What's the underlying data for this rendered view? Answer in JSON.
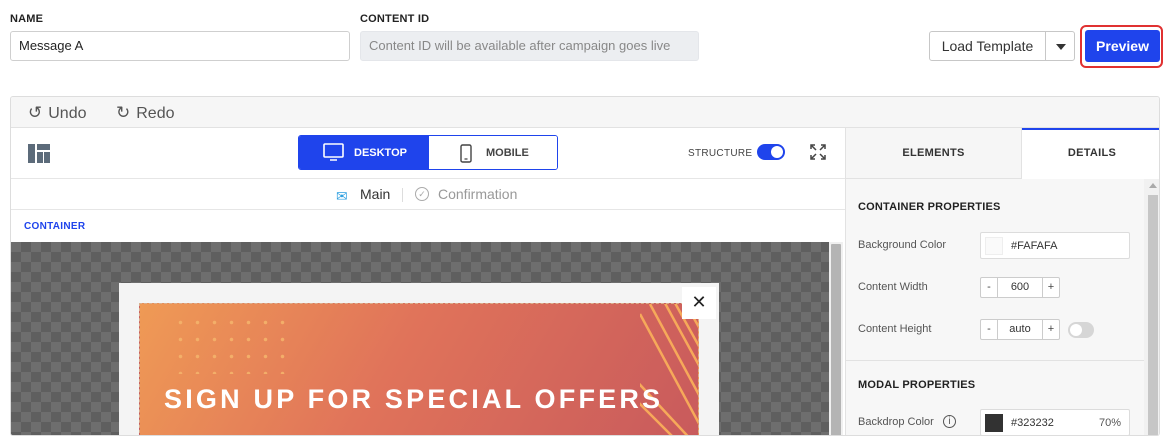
{
  "header": {
    "name_label": "NAME",
    "name_value": "Message A",
    "content_id_label": "CONTENT ID",
    "content_id_placeholder": "Content ID will be available after campaign goes live",
    "load_template_label": "Load Template",
    "preview_label": "Preview"
  },
  "history": {
    "undo_label": "Undo",
    "redo_label": "Redo"
  },
  "toolbar": {
    "desktop_label": "DESKTOP",
    "mobile_label": "MOBILE",
    "structure_label": "STRUCTURE",
    "structure_on": true
  },
  "views": {
    "main_label": "Main",
    "confirmation_label": "Confirmation"
  },
  "canvas": {
    "selection_label": "CONTAINER",
    "close_glyph": "✕",
    "headline": "SIGN UP FOR SPECIAL OFFERS"
  },
  "panel": {
    "tabs": [
      "ELEMENTS",
      "DETAILS"
    ],
    "active_tab": "DETAILS",
    "container_title": "CONTAINER PROPERTIES",
    "bg_color_label": "Background Color",
    "bg_color_value": "#FAFAFA",
    "content_width_label": "Content Width",
    "content_width_value": "600",
    "content_height_label": "Content Height",
    "content_height_value": "auto",
    "modal_title": "MODAL PROPERTIES",
    "backdrop_label": "Backdrop Color",
    "backdrop_value": "#323232",
    "backdrop_opacity": "70%",
    "stepper_minus": "-",
    "stepper_plus": "+"
  },
  "colors": {
    "accent": "#1f44ec",
    "preview_highlight": "#e03131",
    "backdrop_swatch": "#323232",
    "bg_swatch": "#fafafa"
  }
}
